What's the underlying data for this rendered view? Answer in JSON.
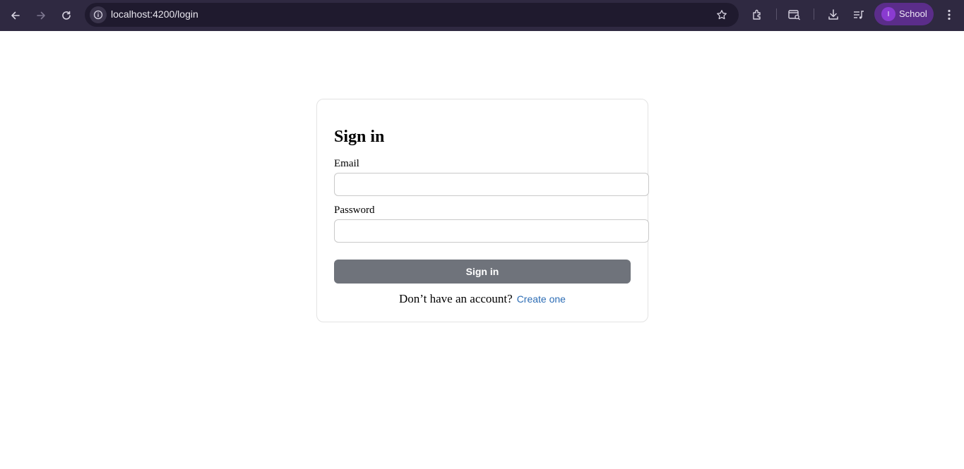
{
  "browser": {
    "url": "localhost:4200/login",
    "profile_initial": "I",
    "profile_name": "School",
    "icons": [
      "back-icon",
      "forward-icon",
      "reload-icon",
      "info-icon",
      "star-icon",
      "extensions-icon",
      "search-tab-icon",
      "download-icon",
      "media-icon",
      "more-icon"
    ],
    "colors": {
      "chrome_bg": "#2f2941",
      "omnibox_bg": "#1f1a2e",
      "profile_bg": "#5b2d8a"
    }
  },
  "login": {
    "title": "Sign in",
    "email_label": "Email",
    "email_value": "",
    "password_label": "Password",
    "password_value": "",
    "submit_label": "Sign in",
    "no_account_text": "Don’t have an account?",
    "create_link": "Create one",
    "colors": {
      "button_bg": "#6f737b",
      "link": "#2d6db5"
    }
  }
}
